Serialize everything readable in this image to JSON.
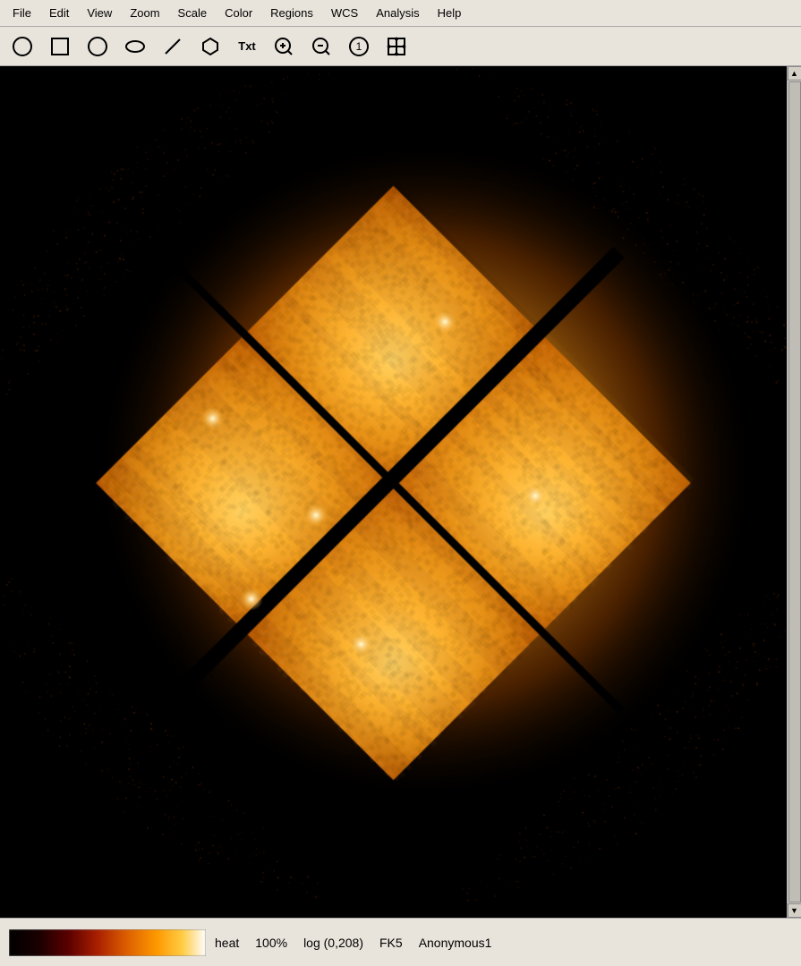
{
  "menubar": {
    "items": [
      "File",
      "Edit",
      "View",
      "Zoom",
      "Scale",
      "Color",
      "Regions",
      "WCS",
      "Analysis",
      "Help"
    ]
  },
  "toolbar": {
    "tools": [
      {
        "name": "circle-tool",
        "label": "○",
        "type": "svg-circle"
      },
      {
        "name": "rectangle-tool",
        "label": "□",
        "type": "svg-rect"
      },
      {
        "name": "circle-tool2",
        "label": "○",
        "type": "svg-circle2"
      },
      {
        "name": "ellipse-tool",
        "label": "○",
        "type": "svg-ellipse"
      },
      {
        "name": "line-tool",
        "label": "/",
        "type": "svg-line"
      },
      {
        "name": "polygon-tool",
        "label": "⬠",
        "type": "svg-polygon"
      },
      {
        "name": "text-tool",
        "label": "Txt",
        "type": "text"
      },
      {
        "name": "zoom-in-tool",
        "label": "⊕",
        "type": "text"
      },
      {
        "name": "zoom-out-tool",
        "label": "⊖",
        "type": "text"
      },
      {
        "name": "zoom-reset-tool",
        "label": "①",
        "type": "text"
      },
      {
        "name": "pan-tool",
        "label": "✛",
        "type": "text"
      }
    ]
  },
  "statusbar": {
    "colormap": "heat",
    "zoom": "100%",
    "scale": "log (0,208)",
    "wcs": "FK5",
    "filename": "Anonymous1"
  },
  "colors": {
    "background": "#000000",
    "menubar_bg": "#e8e4dc",
    "toolbar_bg": "#e8e4dc",
    "statusbar_bg": "#e8e4dc"
  }
}
